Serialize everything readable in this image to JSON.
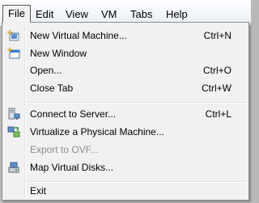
{
  "menubar": {
    "file": "File",
    "edit": "Edit",
    "view": "View",
    "vm": "VM",
    "tabs": "Tabs",
    "help": "Help"
  },
  "file_menu": {
    "items": [
      {
        "label": "New Virtual Machine...",
        "shortcut": "Ctrl+N",
        "icon": "new-vm-icon",
        "enabled": true
      },
      {
        "label": "New Window",
        "shortcut": "",
        "icon": "new-window-icon",
        "enabled": true
      },
      {
        "label": "Open...",
        "shortcut": "Ctrl+O",
        "icon": "",
        "enabled": true
      },
      {
        "label": "Close Tab",
        "shortcut": "Ctrl+W",
        "icon": "",
        "enabled": true
      },
      {
        "label": "Connect to Server...",
        "shortcut": "Ctrl+L",
        "icon": "server-icon",
        "enabled": true
      },
      {
        "label": "Virtualize a Physical Machine...",
        "shortcut": "",
        "icon": "virtualize-icon",
        "enabled": true
      },
      {
        "label": "Export to OVF...",
        "shortcut": "",
        "icon": "",
        "enabled": false
      },
      {
        "label": "Map Virtual Disks...",
        "shortcut": "",
        "icon": "disk-icon",
        "enabled": true
      },
      {
        "label": "Exit",
        "shortcut": "",
        "icon": "",
        "enabled": true
      }
    ]
  }
}
